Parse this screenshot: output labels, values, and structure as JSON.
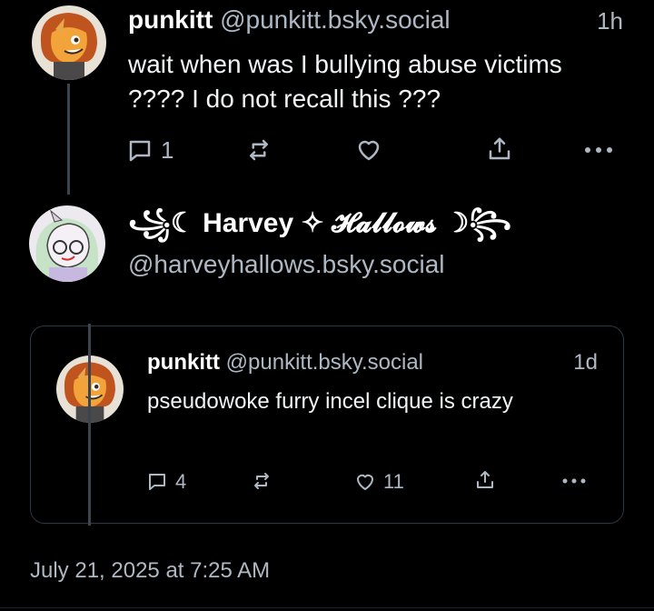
{
  "post1": {
    "author": "punkitt",
    "handle": "@punkitt.bsky.social",
    "time": "1h",
    "text": "wait when was I bullying abuse victims ???? I do not recall this ???",
    "reply_count": "1"
  },
  "post2": {
    "display_name": "꧁☾ Harvey ✧ 𝓗𝓪𝓵𝓵𝓸𝔀𝓼 ☽꧂",
    "handle": "@harveyhallows.bsky.social"
  },
  "quote": {
    "author": "punkitt",
    "handle": "@punkitt.bsky.social",
    "time": "1d",
    "text": "pseudowoke furry incel clique is crazy",
    "reply_count": "4",
    "like_count": "11"
  },
  "footer": {
    "date": "July 21, 2025 at 7:25 AM"
  },
  "colors": {
    "background": "#000000",
    "text": "#f1f3f5",
    "muted": "#aeb8c4",
    "border": "#2e3843"
  }
}
